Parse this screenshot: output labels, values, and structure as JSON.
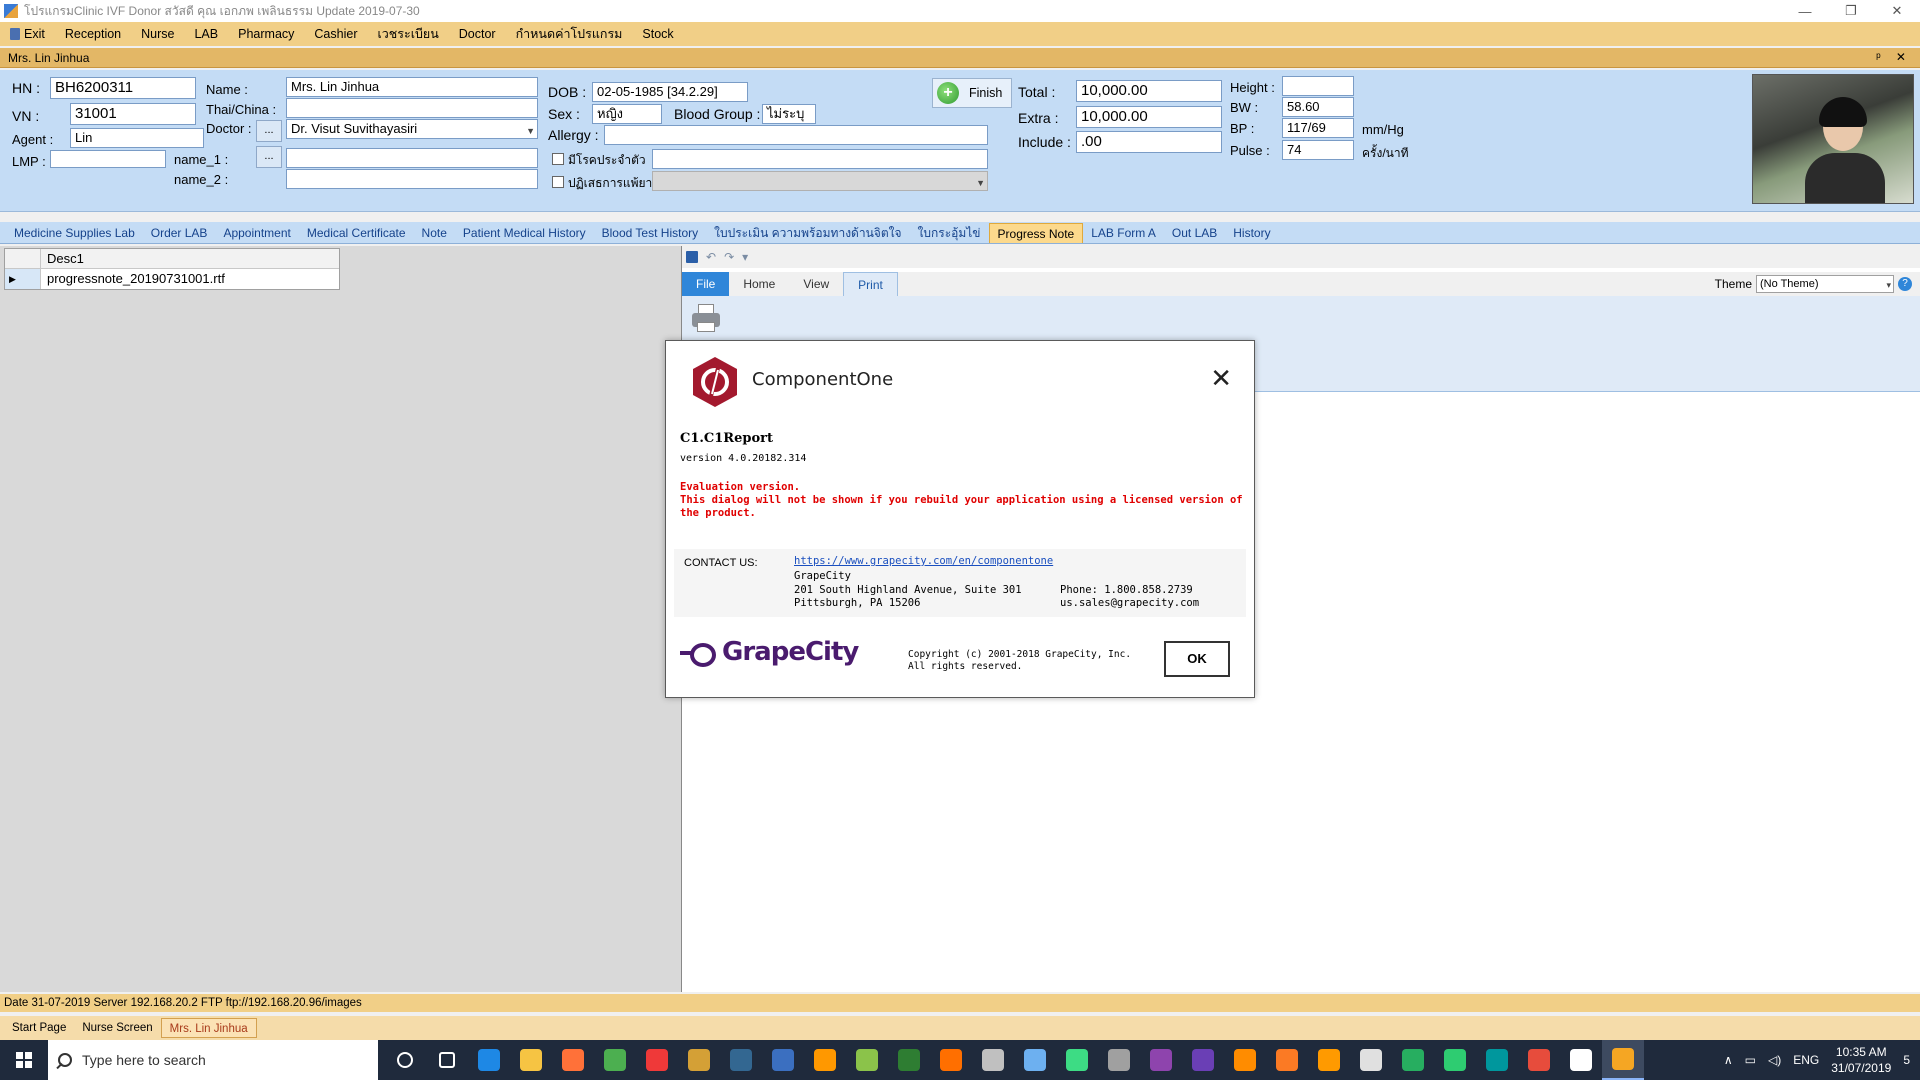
{
  "window": {
    "title": "โปรแกรมClinic IVF Donor สวัสดี คุณ เอกภพ เพลินธรรม Update 2019-07-30",
    "controls": [
      "—",
      "❐",
      "✕"
    ]
  },
  "menu": [
    "Exit",
    "Reception",
    "Nurse",
    "LAB",
    "Pharmacy",
    "Cashier",
    "เวชระเบียน",
    "Doctor",
    "กำหนดค่าโปรแกรม",
    "Stock"
  ],
  "doc_title": "Mrs. Lin Jinhua",
  "doc_controls": "ᵖ ✕",
  "patient": {
    "hn_label": "HN :",
    "hn": "BH6200311",
    "vn_label": "VN :",
    "vn": "31001",
    "agent_label": "Agent :",
    "agent": "Lin",
    "lmp_label": "LMP :",
    "lmp": "",
    "name_label": "Name :",
    "name": "Mrs. Lin Jinhua",
    "thai_label": "Thai/China :",
    "thai": "",
    "doctor_label": "Doctor :",
    "doctor": "Dr. Visut Suvithayasiri",
    "name1_label": "name_1 :",
    "name1": "",
    "name2_label": "name_2 :",
    "name2": "",
    "dots": "...",
    "dob_label": "DOB :",
    "dob": "02-05-1985 [34.2.29]",
    "sex_label": "Sex :",
    "sex": "หญิง",
    "blood_label": "Blood Group :",
    "blood": "ไม่ระบุ",
    "allergy_label": "Allergy :",
    "allergy": "",
    "chk1_label": "มีโรคประจำตัว",
    "chk2_label": "ปฏิเสธการแพ้ยา",
    "finish_label": "Finish",
    "total_label": "Total :",
    "total": "10,000.00",
    "extra_label": "Extra :",
    "extra": "10,000.00",
    "include_label": "Include :",
    "include": ".00",
    "height_label": "Height :",
    "height": "",
    "bw_label": "BW :",
    "bw": "58.60",
    "bp_label": "BP :",
    "bp": "117/69",
    "bp_unit": "mm/Hg",
    "pulse_label": "Pulse :",
    "pulse": "74",
    "pulse_unit": "ครั้ง/นาที"
  },
  "tabs": [
    "Medicine Supplies Lab",
    "Order LAB",
    "Appointment",
    "Medical Certificate",
    "Note",
    "Patient Medical History",
    "Blood Test History",
    "ใบประเมิน ความพร้อมทางด้านจิตใจ",
    "ใบกระอุ้มไข่",
    "Progress Note",
    "LAB Form A",
    "Out LAB",
    "History"
  ],
  "active_tab": "Progress Note",
  "grid": {
    "column": "Desc1",
    "rows": [
      "progressnote_20190731001.rtf"
    ]
  },
  "ribbon": {
    "tabs": [
      "File",
      "Home",
      "View",
      "Print"
    ],
    "theme_label": "Theme",
    "theme_value": "(No Theme)",
    "help": "?"
  },
  "dialog": {
    "brand": "ComponentOne",
    "product": "C1.C1Report",
    "version": "version 4.0.20182.314",
    "eval1": "Evaluation version.",
    "eval2": "This dialog will not be shown if you rebuild your application using a licensed version of the product.",
    "contact_label": "CONTACT US:",
    "url": "https://www.grapecity.com/en/componentone",
    "company": "GrapeCity",
    "address1": "201 South Highland Avenue, Suite 301",
    "address2": "Pittsburgh, PA 15206",
    "phone": "Phone: 1.800.858.2739",
    "email": "us.sales@grapecity.com",
    "logo_text": "GrapeCity",
    "copyright1": "Copyright (c) 2001-2018 GrapeCity, Inc.",
    "copyright2": "All rights reserved.",
    "ok": "OK"
  },
  "status": "Date 31-07-2019 Server 192.168.20.2 FTP ftp://192.168.20.96/images",
  "doc_tabs": [
    "Start Page",
    "Nurse Screen",
    "Mrs. Lin Jinhua"
  ],
  "taskbar": {
    "search_placeholder": "Type here to search",
    "icons": [
      "cortana-icon",
      "task-view-icon",
      "edge-icon",
      "file-explorer-icon",
      "firefox-icon",
      "chrome-icon",
      "vivaldi-icon",
      "app-icon",
      "postgres-icon",
      "app-icon",
      "sublime-icon",
      "notepad-icon",
      "app-icon",
      "app-icon",
      "app-icon",
      "app-icon",
      "android-studio-icon",
      "app-icon",
      "visual-studio-icon",
      "visual-studio-icon",
      "vlc-icon",
      "xampp-icon",
      "illustrator-icon",
      "calculator-icon",
      "app-icon",
      "app-icon",
      "arduino-icon",
      "app-icon",
      "settings-icon",
      "app-icon"
    ],
    "lang": "ENG",
    "time": "10:35 AM",
    "date": "31/07/2019",
    "notif": "5"
  },
  "colors": {
    "menubar": "#f1cf87",
    "header_panel": "#c4dcf5",
    "active_tab": "#fcd98c",
    "eval_red": "#e00000",
    "grapecity_purple": "#4a1b6e",
    "c1_red": "#a3192e"
  }
}
